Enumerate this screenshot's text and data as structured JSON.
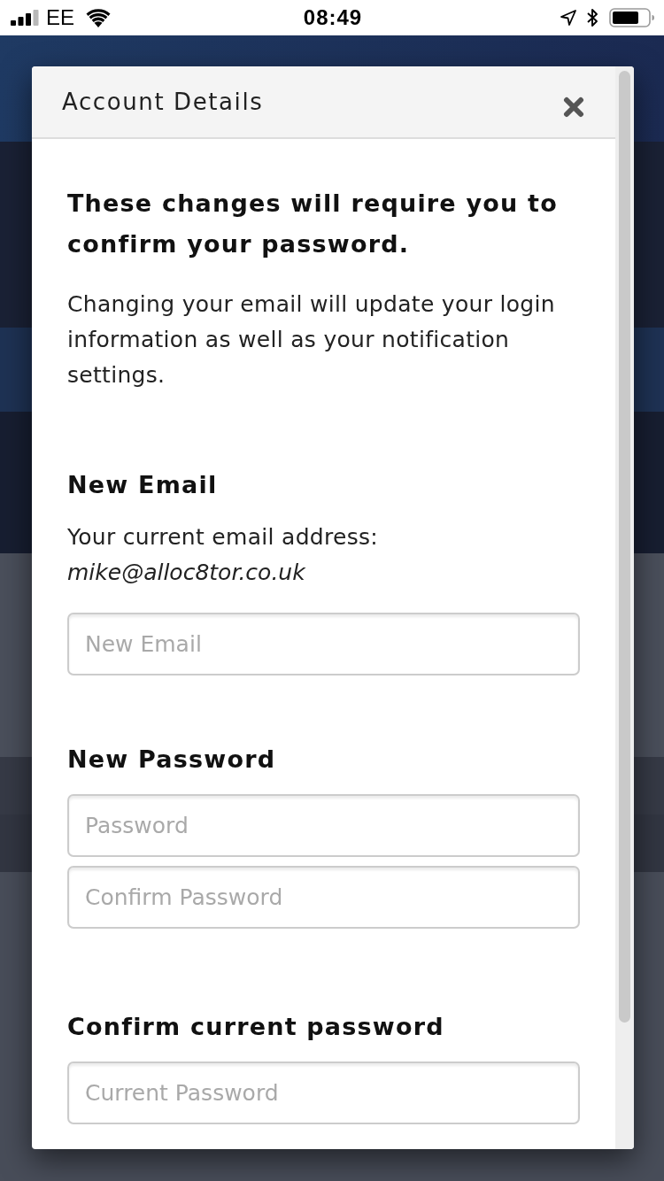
{
  "status_bar": {
    "carrier": "EE",
    "time": "08:49"
  },
  "modal": {
    "title": "Account Details",
    "heading": "These changes will require you to confirm your password.",
    "intro": "Changing your email will update your login information as well as your notification settings.",
    "sections": [
      {
        "heading": "New Email",
        "note": "Your current email address:",
        "current_value": "mike@alloc8tor.co.uk",
        "fields": [
          {
            "placeholder": "New Email"
          }
        ]
      },
      {
        "heading": "New Password",
        "fields": [
          {
            "placeholder": "Password"
          },
          {
            "placeholder": "Confirm Password"
          }
        ]
      },
      {
        "heading": "Confirm current password",
        "fields": [
          {
            "placeholder": "Current Password"
          }
        ]
      }
    ]
  }
}
